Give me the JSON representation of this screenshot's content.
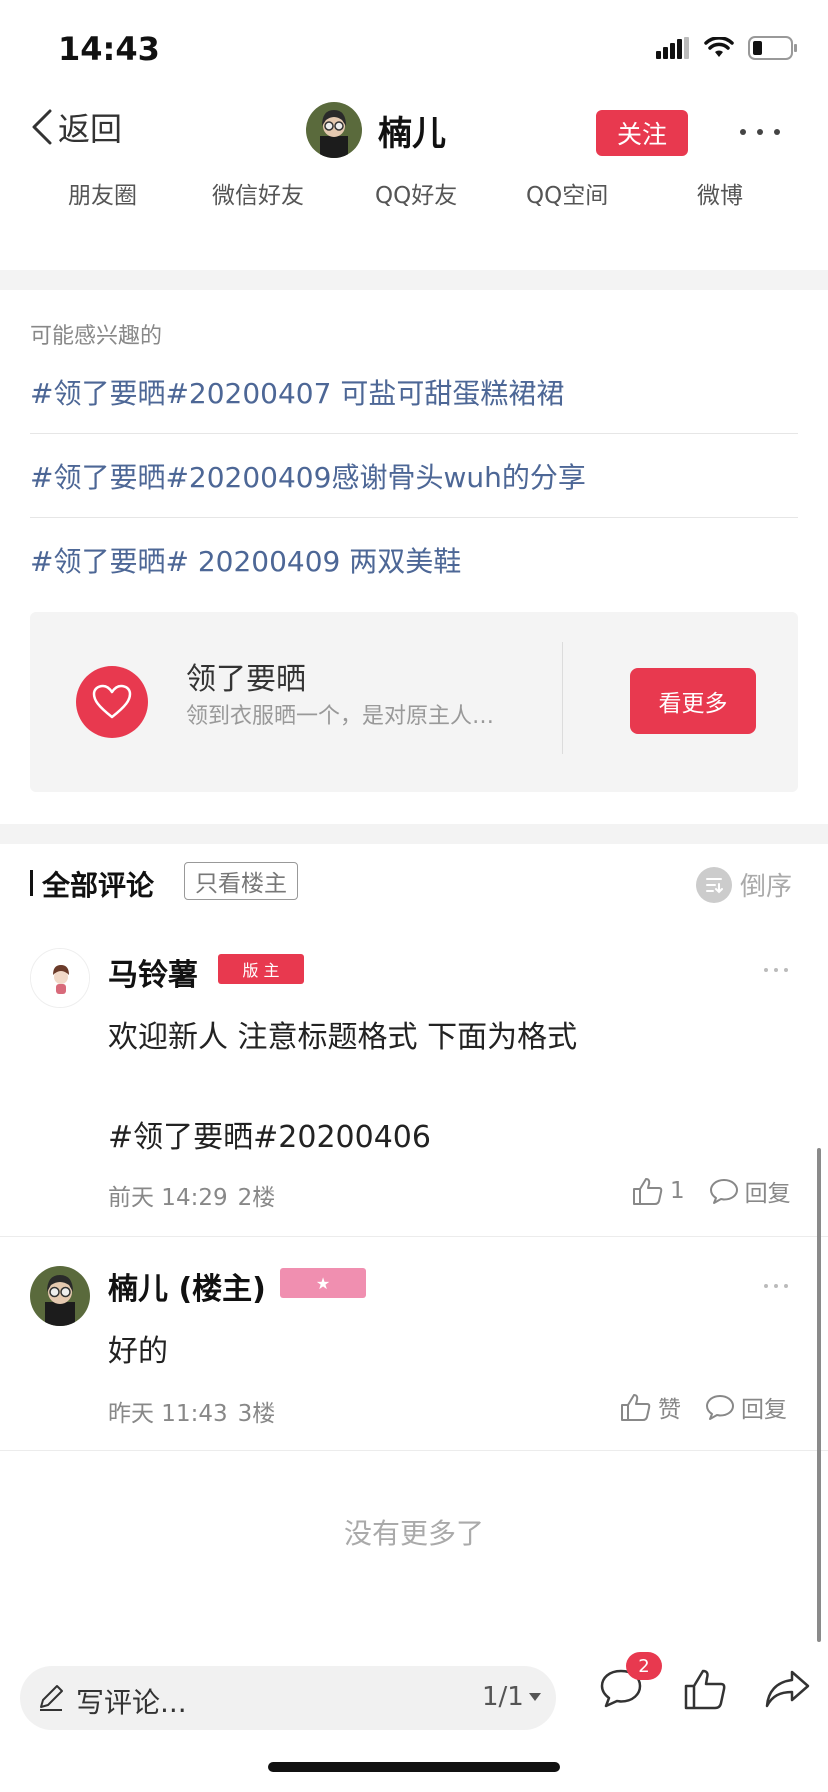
{
  "status_bar": {
    "time": "14:43"
  },
  "nav": {
    "back_label": "返回",
    "user_name": "楠儿",
    "follow_label": "关注"
  },
  "share": {
    "items": [
      "朋友圈",
      "微信好友",
      "QQ好友",
      "QQ空间",
      "微博"
    ]
  },
  "interest": {
    "title": "可能感兴趣的",
    "topics": [
      "#领了要晒#20200407 可盐可甜蛋糕裙裙",
      "#领了要晒#20200409感谢骨头wuh的分享",
      "#领了要晒# 20200409 两双美鞋"
    ]
  },
  "card": {
    "title": "领了要晒",
    "subtitle": "领到衣服晒一个，是对原主人…",
    "button_label": "看更多"
  },
  "comments_header": {
    "title": "全部评论",
    "filter_label": "只看楼主",
    "order_label": "倒序"
  },
  "comments": [
    {
      "author": "马铃薯",
      "badge": "版 主",
      "line1": "欢迎新人 注意标题格式 下面为格式",
      "line2": "#领了要晒#20200406",
      "time": "前天 14:29",
      "floor": "2楼",
      "like_text": "1",
      "reply_label": "回复"
    },
    {
      "author": "楠儿 (楼主)",
      "badge": "★",
      "line1": "好的",
      "time": "昨天 11:43",
      "floor": "3楼",
      "like_text": "赞",
      "reply_label": "回复"
    }
  ],
  "no_more": "没有更多了",
  "bottom_bar": {
    "input_placeholder": "写评论...",
    "page_indicator": "1/1",
    "comment_badge": "2"
  },
  "colors": {
    "accent": "#e8394f",
    "link": "#4d6796",
    "owner_badge": "#f08fb0"
  }
}
